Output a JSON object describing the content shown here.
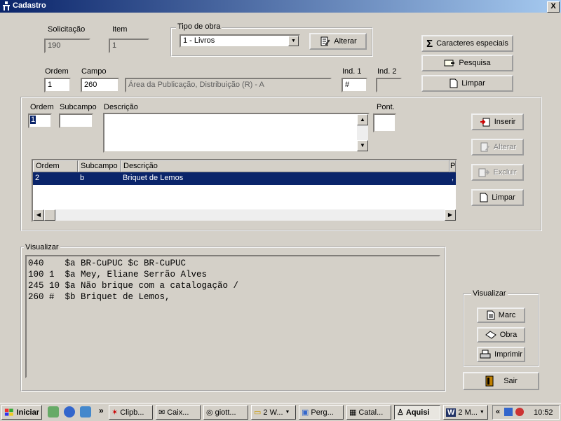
{
  "window": {
    "title": "Cadastro",
    "close_label": "X"
  },
  "top": {
    "solicitacao_label": "Solicitação",
    "solicitacao_value": "190",
    "item_label": "Item",
    "item_value": "1",
    "tipo_obra_legend": "Tipo de obra",
    "tipo_obra_value": "1 - Livros",
    "alterar_label": "Alterar",
    "ordem_label": "Ordem",
    "ordem_value": "1",
    "campo_label": "Campo",
    "campo_value": "260",
    "campo_desc": "Área da Publicação, Distribuição (R) - A",
    "ind1_label": "Ind. 1",
    "ind1_value": "#",
    "ind2_label": "Ind. 2",
    "ind2_value": ""
  },
  "right_buttons": {
    "caracteres": "Caracteres especiais",
    "pesquisa": "Pesquisa",
    "limpar": "Limpar"
  },
  "sub": {
    "ordem_label": "Ordem",
    "ordem_value": "1",
    "subcampo_label": "Subcampo",
    "subcampo_value": "",
    "descricao_label": "Descrição",
    "descricao_value": "",
    "pont_label": "Pont.",
    "pont_value": "",
    "inserir": "Inserir",
    "alterar": "Alterar",
    "excluir": "Excluir",
    "limpar": "Limpar"
  },
  "grid": {
    "headers": [
      "Ordem",
      "Subcampo",
      "Descrição",
      "Po"
    ],
    "rows": [
      {
        "ordem": "2",
        "subcampo": "b",
        "descricao": "Briquet de Lemos",
        "pont": ","
      }
    ]
  },
  "visualizar": {
    "legend": "Visualizar",
    "lines": [
      "040    $a BR-CuPUC $c BR-CuPUC",
      "100 1  $a Mey, Eliane Serrão Alves",
      "245 10 $a Não brique com a catalogação /",
      "260 #  $b Briquet de Lemos,"
    ],
    "box_legend": "Visualizar",
    "marc": "Marc",
    "obra": "Obra",
    "imprimir": "Imprimir"
  },
  "sair": "Sair",
  "taskbar": {
    "start": "Iniciar",
    "tasks": [
      "Clipb...",
      "Caix...",
      "giott...",
      "2 W...",
      "Perg...",
      "Catal...",
      "Aquisi",
      "2 M..."
    ],
    "clock": "10:52"
  }
}
